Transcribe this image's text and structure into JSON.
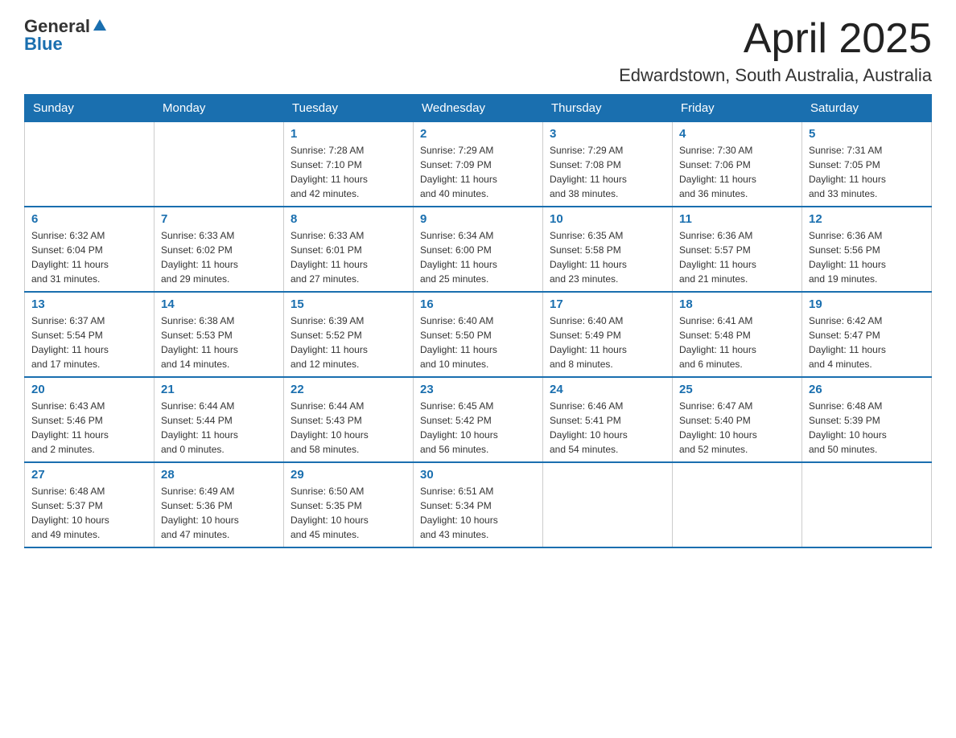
{
  "header": {
    "title": "April 2025",
    "subtitle": "Edwardstown, South Australia, Australia",
    "logo": {
      "general": "General",
      "blue": "Blue"
    }
  },
  "calendar": {
    "days_of_week": [
      "Sunday",
      "Monday",
      "Tuesday",
      "Wednesday",
      "Thursday",
      "Friday",
      "Saturday"
    ],
    "weeks": [
      [
        {
          "day": "",
          "info": ""
        },
        {
          "day": "",
          "info": ""
        },
        {
          "day": "1",
          "info": "Sunrise: 7:28 AM\nSunset: 7:10 PM\nDaylight: 11 hours\nand 42 minutes."
        },
        {
          "day": "2",
          "info": "Sunrise: 7:29 AM\nSunset: 7:09 PM\nDaylight: 11 hours\nand 40 minutes."
        },
        {
          "day": "3",
          "info": "Sunrise: 7:29 AM\nSunset: 7:08 PM\nDaylight: 11 hours\nand 38 minutes."
        },
        {
          "day": "4",
          "info": "Sunrise: 7:30 AM\nSunset: 7:06 PM\nDaylight: 11 hours\nand 36 minutes."
        },
        {
          "day": "5",
          "info": "Sunrise: 7:31 AM\nSunset: 7:05 PM\nDaylight: 11 hours\nand 33 minutes."
        }
      ],
      [
        {
          "day": "6",
          "info": "Sunrise: 6:32 AM\nSunset: 6:04 PM\nDaylight: 11 hours\nand 31 minutes."
        },
        {
          "day": "7",
          "info": "Sunrise: 6:33 AM\nSunset: 6:02 PM\nDaylight: 11 hours\nand 29 minutes."
        },
        {
          "day": "8",
          "info": "Sunrise: 6:33 AM\nSunset: 6:01 PM\nDaylight: 11 hours\nand 27 minutes."
        },
        {
          "day": "9",
          "info": "Sunrise: 6:34 AM\nSunset: 6:00 PM\nDaylight: 11 hours\nand 25 minutes."
        },
        {
          "day": "10",
          "info": "Sunrise: 6:35 AM\nSunset: 5:58 PM\nDaylight: 11 hours\nand 23 minutes."
        },
        {
          "day": "11",
          "info": "Sunrise: 6:36 AM\nSunset: 5:57 PM\nDaylight: 11 hours\nand 21 minutes."
        },
        {
          "day": "12",
          "info": "Sunrise: 6:36 AM\nSunset: 5:56 PM\nDaylight: 11 hours\nand 19 minutes."
        }
      ],
      [
        {
          "day": "13",
          "info": "Sunrise: 6:37 AM\nSunset: 5:54 PM\nDaylight: 11 hours\nand 17 minutes."
        },
        {
          "day": "14",
          "info": "Sunrise: 6:38 AM\nSunset: 5:53 PM\nDaylight: 11 hours\nand 14 minutes."
        },
        {
          "day": "15",
          "info": "Sunrise: 6:39 AM\nSunset: 5:52 PM\nDaylight: 11 hours\nand 12 minutes."
        },
        {
          "day": "16",
          "info": "Sunrise: 6:40 AM\nSunset: 5:50 PM\nDaylight: 11 hours\nand 10 minutes."
        },
        {
          "day": "17",
          "info": "Sunrise: 6:40 AM\nSunset: 5:49 PM\nDaylight: 11 hours\nand 8 minutes."
        },
        {
          "day": "18",
          "info": "Sunrise: 6:41 AM\nSunset: 5:48 PM\nDaylight: 11 hours\nand 6 minutes."
        },
        {
          "day": "19",
          "info": "Sunrise: 6:42 AM\nSunset: 5:47 PM\nDaylight: 11 hours\nand 4 minutes."
        }
      ],
      [
        {
          "day": "20",
          "info": "Sunrise: 6:43 AM\nSunset: 5:46 PM\nDaylight: 11 hours\nand 2 minutes."
        },
        {
          "day": "21",
          "info": "Sunrise: 6:44 AM\nSunset: 5:44 PM\nDaylight: 11 hours\nand 0 minutes."
        },
        {
          "day": "22",
          "info": "Sunrise: 6:44 AM\nSunset: 5:43 PM\nDaylight: 10 hours\nand 58 minutes."
        },
        {
          "day": "23",
          "info": "Sunrise: 6:45 AM\nSunset: 5:42 PM\nDaylight: 10 hours\nand 56 minutes."
        },
        {
          "day": "24",
          "info": "Sunrise: 6:46 AM\nSunset: 5:41 PM\nDaylight: 10 hours\nand 54 minutes."
        },
        {
          "day": "25",
          "info": "Sunrise: 6:47 AM\nSunset: 5:40 PM\nDaylight: 10 hours\nand 52 minutes."
        },
        {
          "day": "26",
          "info": "Sunrise: 6:48 AM\nSunset: 5:39 PM\nDaylight: 10 hours\nand 50 minutes."
        }
      ],
      [
        {
          "day": "27",
          "info": "Sunrise: 6:48 AM\nSunset: 5:37 PM\nDaylight: 10 hours\nand 49 minutes."
        },
        {
          "day": "28",
          "info": "Sunrise: 6:49 AM\nSunset: 5:36 PM\nDaylight: 10 hours\nand 47 minutes."
        },
        {
          "day": "29",
          "info": "Sunrise: 6:50 AM\nSunset: 5:35 PM\nDaylight: 10 hours\nand 45 minutes."
        },
        {
          "day": "30",
          "info": "Sunrise: 6:51 AM\nSunset: 5:34 PM\nDaylight: 10 hours\nand 43 minutes."
        },
        {
          "day": "",
          "info": ""
        },
        {
          "day": "",
          "info": ""
        },
        {
          "day": "",
          "info": ""
        }
      ]
    ]
  }
}
